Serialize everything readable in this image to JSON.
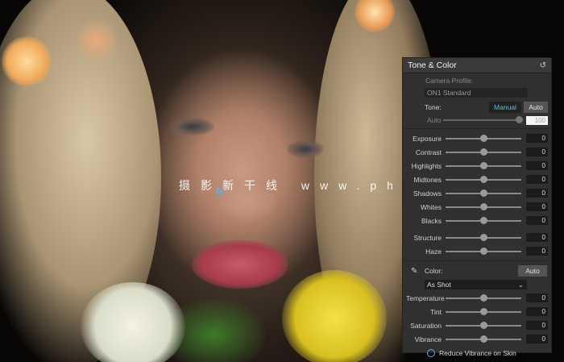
{
  "watermark": "摄影新干线 www.photosks.vip",
  "panel": {
    "title": "Tone & Color",
    "reset_icon": "reset-icon",
    "camera_profile_label": "Camera Profile:",
    "camera_profile_value": "ON1 Standard",
    "tone_label": "Tone:",
    "tone_manual": "Manual",
    "tone_auto": "Auto",
    "auto_label": "Auto",
    "auto_value": "100",
    "tone_sliders": [
      {
        "label": "Exposure",
        "value": "0",
        "pos": 0.5
      },
      {
        "label": "Contrast",
        "value": "0",
        "pos": 0.5
      },
      {
        "label": "Highlights",
        "value": "0",
        "pos": 0.5
      },
      {
        "label": "Midtones",
        "value": "0",
        "pos": 0.5
      },
      {
        "label": "Shadows",
        "value": "0",
        "pos": 0.5
      },
      {
        "label": "Whites",
        "value": "0",
        "pos": 0.5
      },
      {
        "label": "Blacks",
        "value": "0",
        "pos": 0.5
      }
    ],
    "detail_sliders": [
      {
        "label": "Structure",
        "value": "0",
        "pos": 0.5
      },
      {
        "label": "Haze",
        "value": "0",
        "pos": 0.5
      }
    ],
    "color_label": "Color:",
    "color_auto": "Auto",
    "white_balance": "As Shot",
    "color_sliders": [
      {
        "label": "Temperature",
        "value": "0",
        "pos": 0.5
      },
      {
        "label": "Tint",
        "value": "0",
        "pos": 0.5
      },
      {
        "label": "Saturation",
        "value": "0",
        "pos": 0.5
      },
      {
        "label": "Vibrance",
        "value": "0",
        "pos": 0.5
      }
    ],
    "reduce_vibrance": "Reduce Vibrance on Skin",
    "accent_color": "#4ec3e8"
  }
}
